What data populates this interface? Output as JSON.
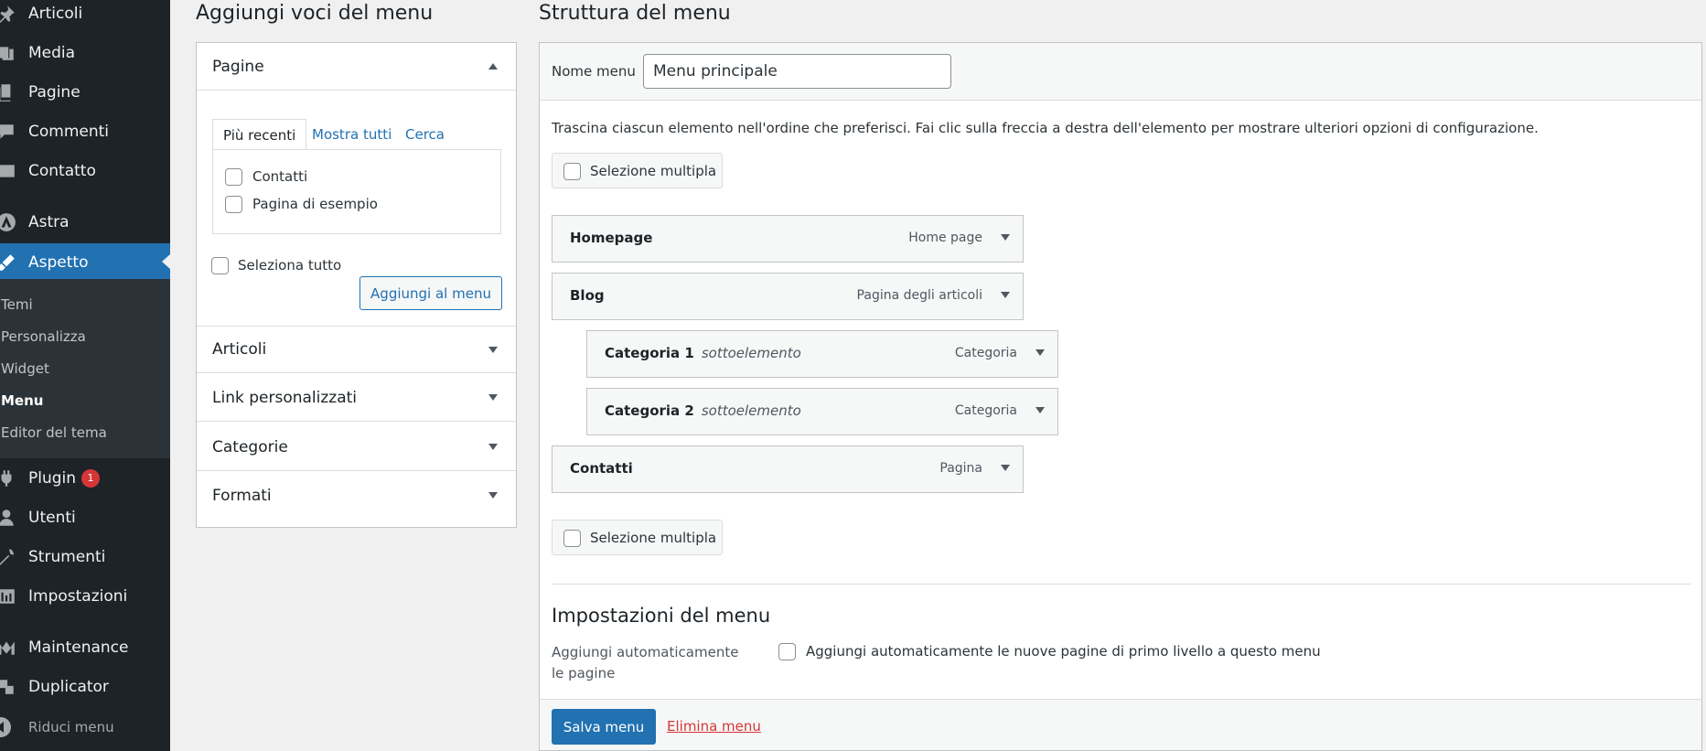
{
  "sidebar": {
    "items": [
      {
        "label": "Articoli",
        "icon": "pin-icon"
      },
      {
        "label": "Media",
        "icon": "media-icon"
      },
      {
        "label": "Pagine",
        "icon": "pages-icon"
      },
      {
        "label": "Commenti",
        "icon": "comments-icon"
      },
      {
        "label": "Contatto",
        "icon": "mail-icon"
      },
      {
        "label": "Astra",
        "icon": "astra-icon"
      },
      {
        "label": "Aspetto",
        "icon": "brush-icon"
      },
      {
        "label": "Plugin",
        "icon": "plugin-icon",
        "badge": "1"
      },
      {
        "label": "Utenti",
        "icon": "user-icon"
      },
      {
        "label": "Strumenti",
        "icon": "wrench-icon"
      },
      {
        "label": "Impostazioni",
        "icon": "settings-icon"
      },
      {
        "label": "Maintenance",
        "icon": "maintenance-icon"
      },
      {
        "label": "Duplicator",
        "icon": "duplicator-icon"
      }
    ],
    "submenu": [
      "Temi",
      "Personalizza",
      "Widget",
      "Menu",
      "Editor del tema"
    ],
    "collapse_label": "Riduci menu"
  },
  "left": {
    "heading": "Aggiungi voci del menu",
    "pages_section": "Pagine",
    "tabs": [
      "Più recenti",
      "Mostra tutti",
      "Cerca"
    ],
    "page_items": [
      "Contatti",
      "Pagina di esempio"
    ],
    "select_all": "Seleziona tutto",
    "add_button": "Aggiungi al menu",
    "sections": [
      "Articoli",
      "Link personalizzati",
      "Categorie",
      "Formati"
    ]
  },
  "right": {
    "heading": "Struttura del menu",
    "name_label": "Nome menu",
    "name_value": "Menu principale",
    "instructions": "Trascina ciascun elemento nell'ordine che preferisci. Fai clic sulla freccia a destra dell'elemento per mostrare ulteriori opzioni di configurazione.",
    "multi_select": "Selezione multipla",
    "menu_items": [
      {
        "title": "Homepage",
        "sub": "",
        "type": "Home page"
      },
      {
        "title": "Blog",
        "sub": "",
        "type": "Pagina degli articoli"
      },
      {
        "title": "Categoria 1",
        "sub": "sottoelemento",
        "type": "Categoria"
      },
      {
        "title": "Categoria 2",
        "sub": "sottoelemento",
        "type": "Categoria"
      },
      {
        "title": "Contatti",
        "sub": "",
        "type": "Pagina"
      }
    ],
    "settings_heading": "Impostazioni del menu",
    "auto_add_label": "Aggiungi automaticamente le pagine",
    "auto_add_option": "Aggiungi automaticamente le nuove pagine di primo livello a questo menu",
    "save_button": "Salva menu",
    "delete_link": "Elimina menu"
  },
  "colors": {
    "sidebar_bg": "#1d2327",
    "accent": "#2271b1",
    "danger": "#d63638"
  }
}
